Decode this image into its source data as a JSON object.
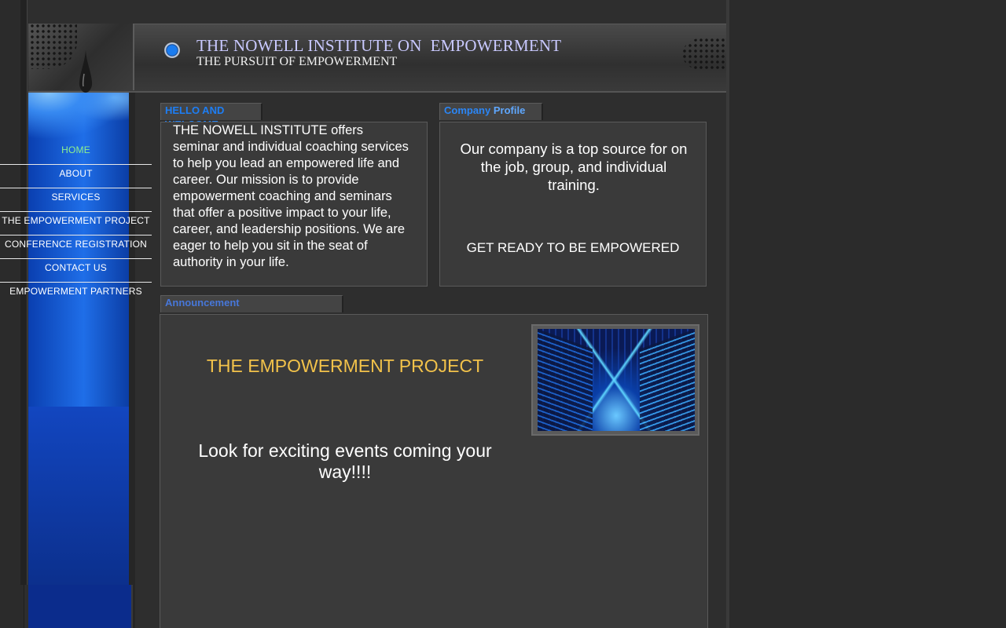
{
  "header": {
    "title": "THE NOWELL INSTITUTE ON  EMPOWERMENT",
    "subtitle": "THE PURSUIT OF EMPOWERMENT"
  },
  "nav": {
    "items": [
      {
        "label": "HOME",
        "active": true
      },
      {
        "label": "ABOUT"
      },
      {
        "label": "SERVICES"
      },
      {
        "label": "THE EMPOWERMENT PROJECT"
      },
      {
        "label": "CONFERENCE REGISTRATION"
      },
      {
        "label": "CONTACT US"
      },
      {
        "label": "EMPOWERMENT PARTNERS"
      }
    ]
  },
  "welcome": {
    "tab_label": "HELLO AND WELCOME",
    "text": "THE NOWELL INSTITUTE  offers seminar and individual coaching services to help you lead an empowered  life and career.   Our mission is to provide empowerment coaching and seminars that offer a positive impact to your life, career, and leadership positions.  We are eager to help you sit in the seat of authority in your life."
  },
  "profile": {
    "tab_word1": "Company",
    "tab_word2": "Profile",
    "text": "Our company is a top source for on the job, group, and individual training.",
    "cta": "GET READY TO BE EMPOWERED"
  },
  "announcement": {
    "tab_label": "Announcement",
    "title": "THE EMPOWERMENT PROJECT",
    "text": "Look for exciting events coming your way!!!!"
  },
  "colors": {
    "accent_blue": "#1d7ef5",
    "title_gold": "#f2c24a",
    "active_nav": "#8ef08e"
  }
}
